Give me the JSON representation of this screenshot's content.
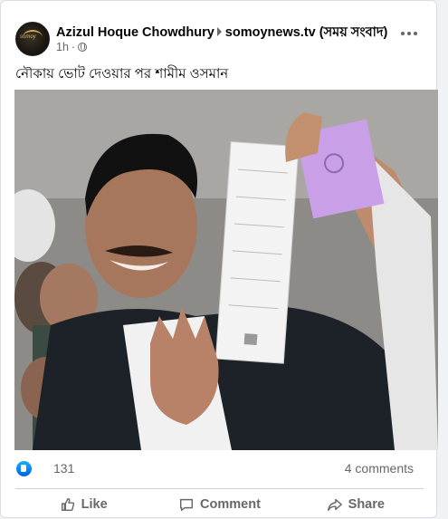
{
  "post": {
    "author": "Azizul Hoque Chowdhury",
    "shared_to": "somoynews.tv (সময় সংবাদ)",
    "time": "1h",
    "dot": "·",
    "text": "নৌকায় ভোট দেওয়ার পর শামীম ওসমান",
    "avatar_icon": "somoy-logo-avatar",
    "privacy_icon": "globe-icon"
  },
  "photo": {
    "description_icon": "news-photo",
    "accent_colors": {
      "ballot_white": "#f2f2f2",
      "ballot_pink": "#c9a0e8"
    }
  },
  "stats": {
    "reaction_count": "131",
    "comments": "4 comments"
  },
  "actions": {
    "like": "Like",
    "comment": "Comment",
    "share": "Share"
  },
  "colors": {
    "brand_blue": "#1877f2",
    "secondary_text": "#65676b",
    "divider": "#ced0d4"
  }
}
